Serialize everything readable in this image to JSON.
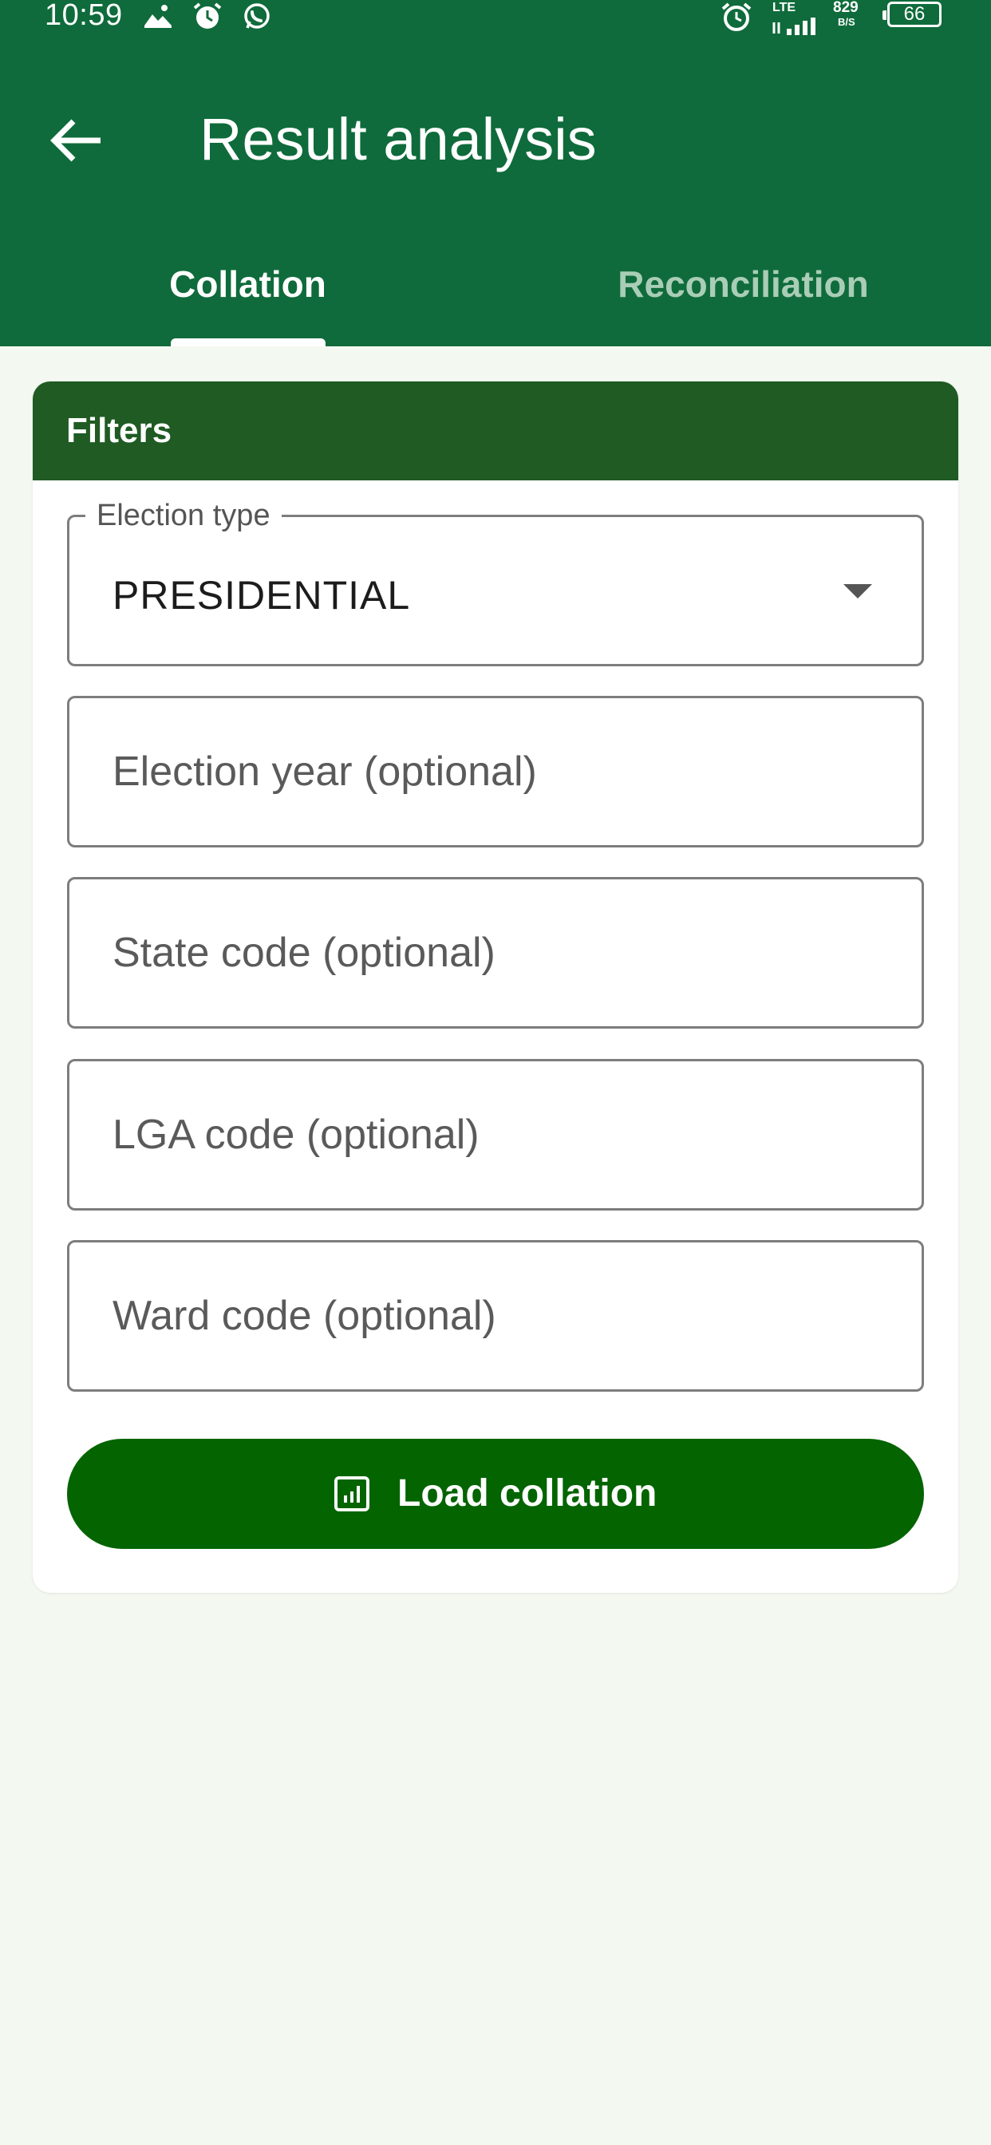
{
  "status_bar": {
    "time": "10:59",
    "left_icons": [
      "gallery-icon",
      "alarm-icon",
      "whatsapp-icon"
    ],
    "right_icons": [
      "alarm-clock-icon",
      "lte-signal-icon",
      "network-speed-icon",
      "battery-icon"
    ],
    "network": "LTE",
    "speed_value": "829",
    "speed_unit": "B/S",
    "battery": "66"
  },
  "app_bar": {
    "title": "Result analysis",
    "back_icon": "arrow-left-icon",
    "background": "#0f6b3b"
  },
  "tabs": [
    {
      "label": "Collation",
      "active": true
    },
    {
      "label": "Reconciliation",
      "active": false
    }
  ],
  "filters": {
    "header": "Filters",
    "header_color": "#1f5b23",
    "election_type": {
      "label": "Election type",
      "value": "PRESIDENTIAL"
    },
    "fields": [
      {
        "placeholder": "Election year (optional)",
        "value": ""
      },
      {
        "placeholder": "State code (optional)",
        "value": ""
      },
      {
        "placeholder": "LGA code (optional)",
        "value": ""
      },
      {
        "placeholder": "Ward code (optional)",
        "value": ""
      }
    ],
    "load_button": {
      "label": "Load collation",
      "icon": "chart-box-icon",
      "color": "#036400"
    }
  }
}
